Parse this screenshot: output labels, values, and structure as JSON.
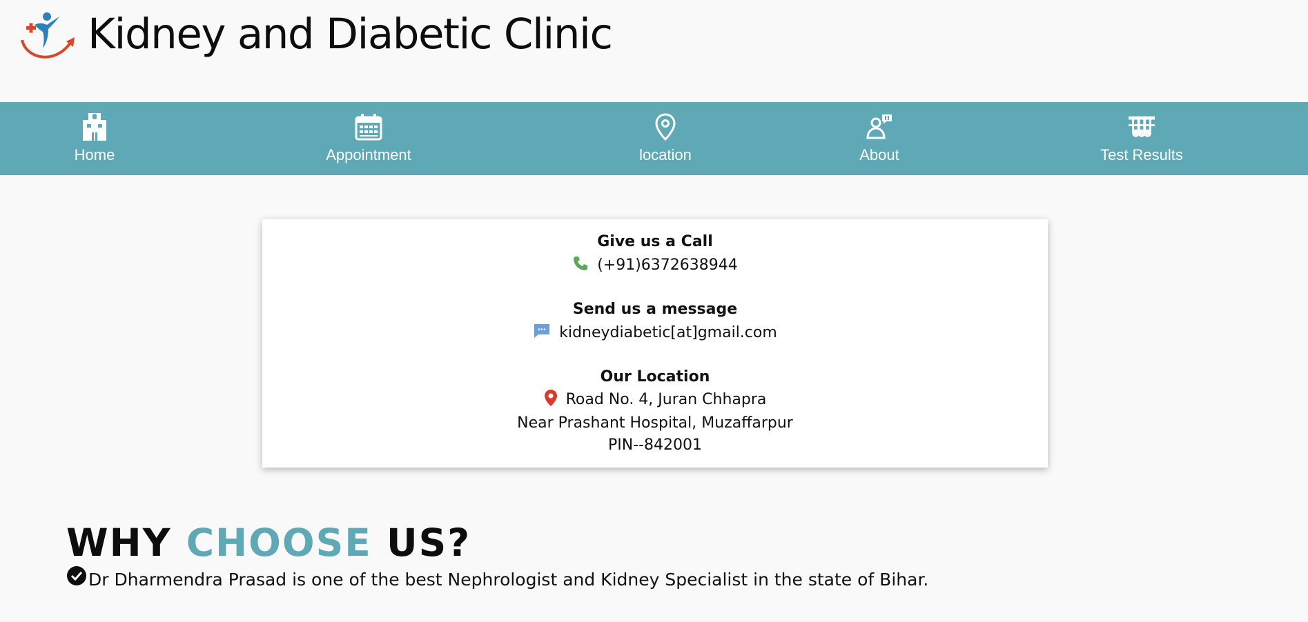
{
  "header": {
    "logo_name": "clinic-logo",
    "title": "Kidney and Diabetic Clinic"
  },
  "nav": {
    "items": [
      {
        "label": "Home",
        "icon": "hospital-icon"
      },
      {
        "label": "Appointment",
        "icon": "calendar-icon"
      },
      {
        "label": "location",
        "icon": "map-pin-icon"
      },
      {
        "label": "About",
        "icon": "doctor-icon"
      },
      {
        "label": "Test Results",
        "icon": "test-tubes-icon"
      }
    ]
  },
  "contact": {
    "call_title": "Give us a Call",
    "phone": "(+91)6372638944",
    "message_title": "Send us a message",
    "email": "kidneydiabetic[at]gmail.com",
    "location_title": "Our Location",
    "address_line1": "Road No. 4, Juran Chhapra",
    "address_line2": "Near Prashant Hospital, Muzaffarpur",
    "address_line3": "PIN--842001"
  },
  "why": {
    "heading_part1": "WHY",
    "heading_accent": "CHOOSE",
    "heading_part2": "US?",
    "reasons": [
      "Dr Dharmendra Prasad is one of the best Nephrologist and Kidney Specialist in the state of Bihar."
    ]
  },
  "colors": {
    "nav_background": "#5fa8b5",
    "accent": "#5fa8b5",
    "phone_icon": "#5aa85a",
    "message_icon": "#6b9fd8",
    "location_icon": "#d93a2b"
  }
}
